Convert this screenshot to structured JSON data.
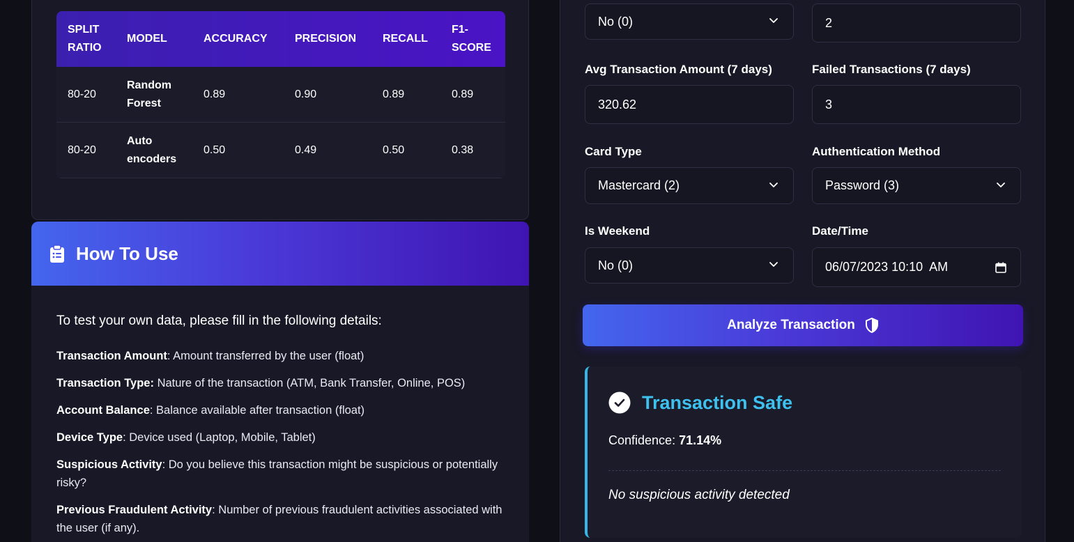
{
  "metrics_table": {
    "headers": [
      "Split Ratio",
      "Model",
      "Accuracy",
      "Precision",
      "Recall",
      "F1-Score"
    ],
    "rows": [
      [
        "80-20",
        "Random Forest",
        "0.89",
        "0.90",
        "0.89",
        "0.89"
      ],
      [
        "80-20",
        "Auto encoders",
        "0.50",
        "0.49",
        "0.50",
        "0.38"
      ]
    ]
  },
  "how_to_use": {
    "title": "How To Use",
    "intro": "To test your own data, please fill in the following details:",
    "items": [
      {
        "term": "Transaction Amount",
        "desc": ": Amount transferred by the user (float)"
      },
      {
        "term": "Transaction Type:",
        "desc": " Nature of the transaction (ATM, Bank Transfer, Online, POS)"
      },
      {
        "term": "Account Balance",
        "desc": ": Balance available after transaction (float)"
      },
      {
        "term": "Device Type",
        "desc": ": Device used (Laptop, Mobile, Tablet)"
      },
      {
        "term": "Suspicious Activity",
        "desc": ": Do you believe this transaction might be suspicious or potentially risky?"
      },
      {
        "term": "Previous Fraudulent Activity",
        "desc": ": Number of previous fraudulent activities associated with the user (if any)."
      }
    ]
  },
  "form": {
    "top_left_value": "No (0)",
    "top_right_value": "2",
    "avg_amount": {
      "label": "Avg Transaction Amount (7 days)",
      "value": "320.62"
    },
    "failed_tx": {
      "label": "Failed Transactions (7 days)",
      "value": "3"
    },
    "card_type": {
      "label": "Card Type",
      "value": "Mastercard (2)"
    },
    "auth_method": {
      "label": "Authentication Method",
      "value": "Password (3)"
    },
    "is_weekend": {
      "label": "Is Weekend",
      "value": "No (0)"
    },
    "datetime": {
      "label": "Date/Time",
      "value": "06/07/2023 10:10  AM"
    },
    "analyze_label": "Analyze Transaction"
  },
  "result": {
    "title": "Transaction Safe",
    "confidence_label": "Confidence: ",
    "confidence_value": "71.14%",
    "note": "No suspicious activity detected",
    "accent_color": "#3ec1ef"
  }
}
